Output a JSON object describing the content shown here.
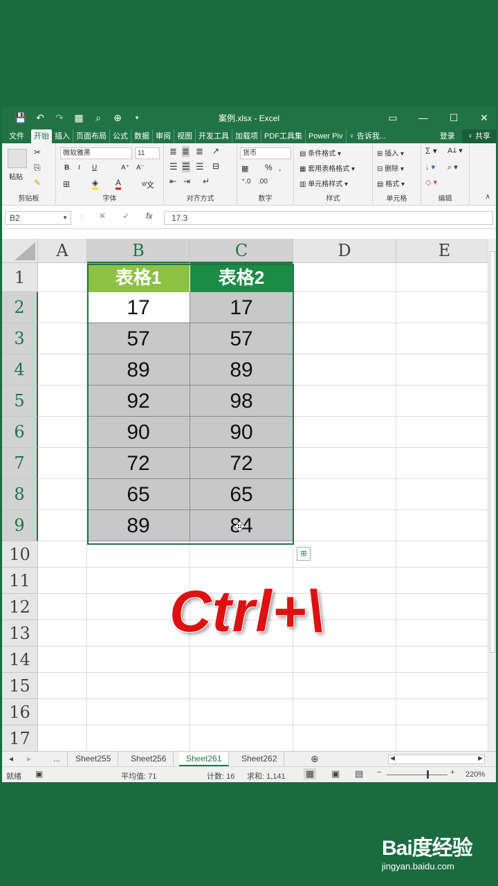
{
  "window": {
    "title": "案例.xlsx - Excel",
    "qat": [
      "💾",
      "↶",
      "↷",
      "▦",
      "⌕",
      "⊕",
      "▾"
    ],
    "controls": [
      "▭",
      "—",
      "☐",
      "✕"
    ]
  },
  "tabs": {
    "file": "文件",
    "items": [
      "开始",
      "插入",
      "页面布局",
      "公式",
      "数据",
      "审阅",
      "视图",
      "开发工具",
      "加载项",
      "PDF工具集",
      "Power Piv"
    ],
    "active": "开始",
    "tell_me": "♀ 告诉我...",
    "login": "登录",
    "share": "♀ 共享"
  },
  "ribbon": {
    "clipboard": {
      "paste": "粘贴",
      "label": "剪贴板"
    },
    "font": {
      "name": "微软雅黑",
      "size": "11",
      "bold": "B",
      "italic": "I",
      "underline": "U",
      "grow": "A⁺",
      "shrink": "A⁻",
      "label": "字体"
    },
    "alignment": {
      "label": "对齐方式"
    },
    "number": {
      "format": "货币",
      "percent": "%",
      "comma": ",",
      "label": "数字"
    },
    "styles": {
      "conditional": "条件格式 ▾",
      "table": "套用表格格式 ▾",
      "cell": "单元格样式 ▾",
      "label": "样式"
    },
    "cells": {
      "insert": "插入 ▾",
      "delete": "删除 ▾",
      "format": "格式 ▾",
      "label": "单元格"
    },
    "editing": {
      "sum": "Σ ▾",
      "sort": "Aↆ ▾",
      "fill": "↓ ▾",
      "find": "⌕ ▾",
      "clear": "◇ ▾",
      "label": "编辑"
    }
  },
  "formula_bar": {
    "name_box": "B2",
    "cancel": "✕",
    "enter": "✓",
    "fx": "fx",
    "value": "17.3"
  },
  "grid": {
    "columns": [
      "A",
      "B",
      "C",
      "D",
      "E"
    ],
    "rows": [
      "1",
      "2",
      "3",
      "4",
      "5",
      "6",
      "7",
      "8",
      "9",
      "10",
      "11",
      "12",
      "13",
      "14",
      "15",
      "16",
      "17"
    ],
    "headers": [
      "表格1",
      "表格2"
    ],
    "header_colors": [
      "#8dc043",
      "#1a8c46"
    ],
    "table1": [
      "17",
      "57",
      "89",
      "92",
      "90",
      "72",
      "65",
      "89"
    ],
    "table2": [
      "17",
      "57",
      "89",
      "98",
      "90",
      "72",
      "65",
      "84"
    ]
  },
  "overlay": "Ctrl+\\",
  "sheets": {
    "nav": [
      "◂",
      "▸",
      "..."
    ],
    "items": [
      "Sheet255",
      "Sheet256",
      "Sheet261",
      "Sheet262"
    ],
    "active": "Sheet261",
    "add": "⊕"
  },
  "status": {
    "mode": "就绪",
    "average": "平均值: 71",
    "count": "计数: 16",
    "sum": "求和: 1,141",
    "zoom": "220%"
  },
  "watermark": {
    "logo": "Bai度经验",
    "url": "jingyan.baidu.com"
  }
}
